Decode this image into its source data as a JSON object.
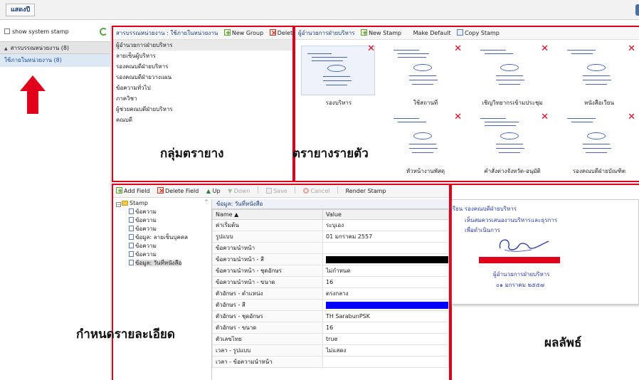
{
  "topbar": {
    "tab_label": "แสดงปี"
  },
  "left": {
    "show_system_stamp": "show system stamp",
    "group_header": "สารบรรณหน่วยงาน (8)",
    "group_item": "ใช้ภายในหน่วยงาน (8)"
  },
  "group_panel": {
    "title": "สารบรรณหน่วยงาน : ใช้ภายในหน่วยงาน",
    "new_group": "New Group",
    "delete_group": "Delete Group",
    "items": [
      "ผู้อำนวยการฝ่ายบริหาร",
      "ลายเซ็นผู้บริหาร",
      "รองคณบดีฝ่ายบริหาร",
      "รองคณบดีฝ่ายวางแผน",
      "ข้อความทั่วไป",
      "ภาควิชา",
      "ผู้ช่วยคณบดีฝ่ายบริหาร",
      "คณบดี"
    ],
    "big_label": "กลุ่มตรายาง"
  },
  "stamp_panel": {
    "title": "ผู้อำนวยการฝ่ายบริหาร",
    "new_stamp": "New Stamp",
    "make_default": "Make Default",
    "copy_stamp": "Copy Stamp",
    "big_label": "ตรายางรายตัว",
    "stamps": [
      {
        "name": "รองบริหาร"
      },
      {
        "name": "ใช้สถานที่"
      },
      {
        "name": "เชิญวิทยากรเข้ามประชุม"
      },
      {
        "name": "หนังสือเวียน"
      },
      {
        "name": ""
      },
      {
        "name": "หัวหน้างานพัสดุ"
      },
      {
        "name": "คำสั่งต่างจังหวัด-อนุมัติ"
      },
      {
        "name": "รองคณบดีฝ่ายบัณฑิต"
      }
    ]
  },
  "details": {
    "add_field": "Add Field",
    "delete_field": "Delete Field",
    "up": "Up",
    "down": "Down",
    "save": "Save",
    "cancel": "Cancel",
    "render_stamp": "Render Stamp",
    "big_label": "กำหนดรายละเอียด",
    "tree_root": "Stamp",
    "tree_items": [
      "ข้อความ",
      "ข้อความ",
      "ข้อความ",
      "ข้อมูล: ลายเซ็นบุคคล",
      "ข้อความ",
      "ข้อความ",
      "ข้อมูล: วันที่หนังสือ"
    ],
    "prop_title": "ข้อมูล: วันที่หนังสือ",
    "col_name": "Name",
    "col_value": "Value",
    "rows": [
      {
        "k": "ค่าเริ่มต้น",
        "v": "ระบุเอง"
      },
      {
        "k": "รูปแบบ",
        "v": "01 มกราคม 2557"
      },
      {
        "k": "ข้อความนำหน้า",
        "v": ""
      },
      {
        "k": "ข้อความนำหน้า - สี",
        "v": "",
        "color": "#000000"
      },
      {
        "k": "ข้อความนำหน้า - ชุดอักษร",
        "v": "ไม่กำหนด"
      },
      {
        "k": "ข้อความนำหน้า - ขนาด",
        "v": "16"
      },
      {
        "k": "ตัวอักษร - ตำแหน่ง",
        "v": "ตรงกลาง"
      },
      {
        "k": "ตัวอักษร - สี",
        "v": "",
        "color": "#0000ff"
      },
      {
        "k": "ตัวอักษร - ชุดอักษร",
        "v": "TH SarabunPSK"
      },
      {
        "k": "ตัวอักษร - ขนาด",
        "v": "16"
      },
      {
        "k": "ตัวเลขไทย",
        "v": "true"
      },
      {
        "k": "เวลา - รูปแบบ",
        "v": "ไม่แสดง"
      },
      {
        "k": "เวลา - ข้อความนำหน้า",
        "v": ""
      }
    ]
  },
  "result": {
    "line1": "เรียน รองคณบดีฝ่ายบริหาร",
    "line2": "เห็นสมควรเสนองานบริหารและธุรการ",
    "line3": "เพื่อดำเนินการ",
    "sign_title": "ผู้อำนวยการฝ่ายบริหาร",
    "date": "๐๑ มกราคม ๒๕๕๗",
    "big_label": "ผลลัพธ์"
  },
  "colors": {
    "accent_red": "#e0001b",
    "link_blue": "#1a3d7c"
  }
}
